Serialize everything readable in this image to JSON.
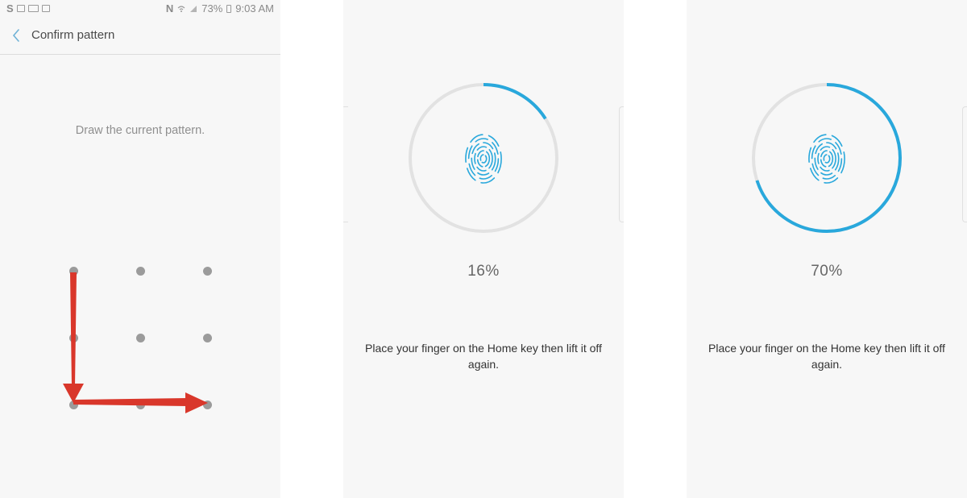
{
  "status_bar": {
    "carrier_icon": "S",
    "icons_left": [
      "gallery-icon",
      "photo-icon",
      "message-icon"
    ],
    "nfc": "N",
    "battery_percent": "73%",
    "time": "9:03 AM"
  },
  "confirm_pattern": {
    "title": "Confirm pattern",
    "instruction": "Draw the current pattern.",
    "grid": [
      "top-left",
      "top-center",
      "top-right",
      "middle-left",
      "middle-center",
      "middle-right",
      "bottom-left",
      "bottom-center",
      "bottom-right"
    ],
    "pattern_path": [
      "top-left",
      "bottom-left",
      "bottom-right"
    ],
    "arrow_color": "#d9372b"
  },
  "fingerprint_steps": [
    {
      "progress": 0.16,
      "percent_label": "16%",
      "prompt": "Place your finger on the Home key then lift it off again."
    },
    {
      "progress": 0.7,
      "percent_label": "70%",
      "prompt": "Place your finger on the Home key then lift it off again."
    }
  ],
  "colors": {
    "accent": "#29a8dc",
    "track": "#e2e2e2",
    "arrow": "#d9372b"
  }
}
